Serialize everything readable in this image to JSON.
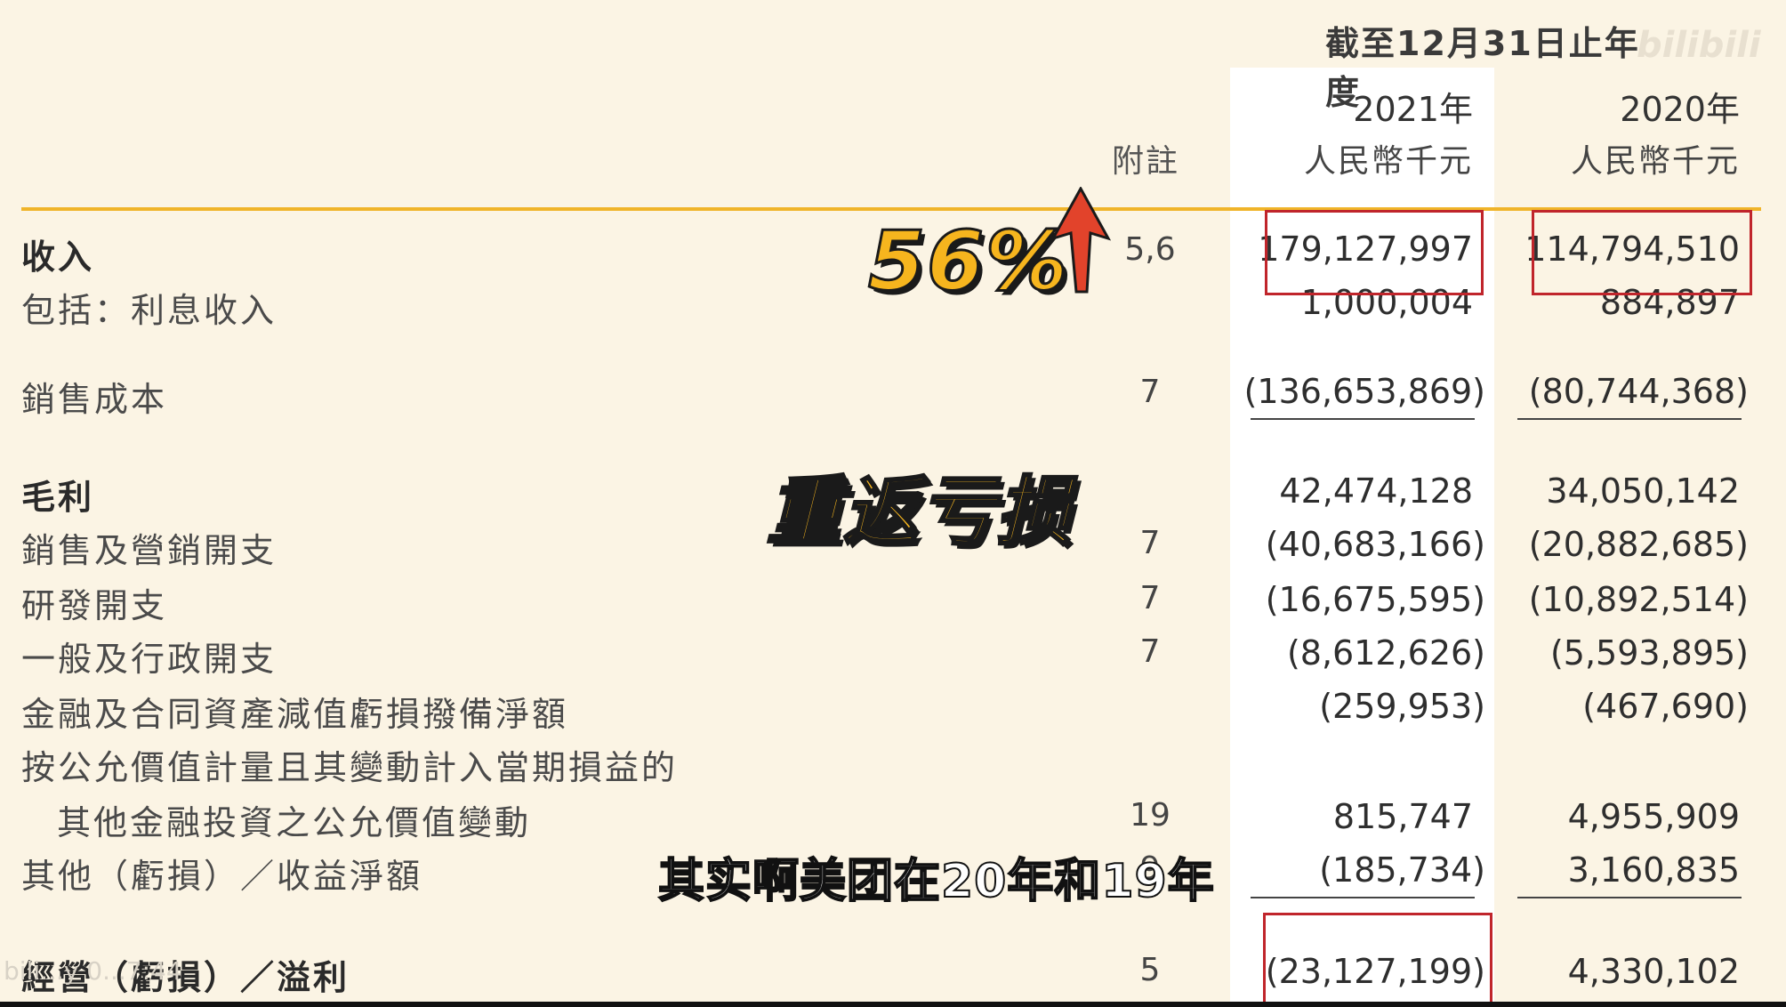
{
  "header": {
    "period": "截至12月31日止年度",
    "watermark": "bilibili",
    "note_label": "附註",
    "year_2021": "2021年",
    "year_2020": "2020年",
    "unit_2021": "人民幣千元",
    "unit_2020": "人民幣千元"
  },
  "rows": [
    {
      "label": "收入",
      "note": "5,6",
      "y2021": "179,127,997",
      "y2020": "114,794,510"
    },
    {
      "label": "包括：利息收入",
      "note": "",
      "y2021": "1,000,004",
      "y2020": "884,897"
    },
    {
      "label": "銷售成本",
      "note": "7",
      "y2021": "(136,653,869)",
      "y2020": "(80,744,368)"
    },
    {
      "label": "毛利",
      "note": "",
      "y2021": "42,474,128",
      "y2020": "34,050,142"
    },
    {
      "label": "銷售及營銷開支",
      "note": "7",
      "y2021": "(40,683,166)",
      "y2020": "(20,882,685)"
    },
    {
      "label": "研發開支",
      "note": "7",
      "y2021": "(16,675,595)",
      "y2020": "(10,892,514)"
    },
    {
      "label": "一般及行政開支",
      "note": "7",
      "y2021": "(8,612,626)",
      "y2020": "(5,593,895)"
    },
    {
      "label": "金融及合同資產減值虧損撥備淨額",
      "note": "",
      "y2021": "(259,953)",
      "y2020": "(467,690)"
    },
    {
      "label": "按公允價值計量且其變動計入當期損益的",
      "note": "",
      "y2021": "",
      "y2020": ""
    },
    {
      "label": "其他金融投資之公允價值變動",
      "note": "19",
      "y2021": "815,747",
      "y2020": "4,955,909"
    },
    {
      "label": "其他（虧損）／收益淨額",
      "note": "9",
      "y2021": "(185,734)",
      "y2020": "3,160,835"
    },
    {
      "label": "經營（虧損）／溢利",
      "note": "5",
      "y2021": "(23,127,199)",
      "y2020": "4,330,102"
    }
  ],
  "overlays": {
    "growth_sticker": "56%",
    "loss_sticker": "重返亏损",
    "subtitle": "其实啊美团在20年和19年",
    "timestamp": "bili...y  0...7:44"
  },
  "colors": {
    "background": "#fbf4e4",
    "highlight_column": "#ffffff",
    "rule": "#f0b429",
    "box": "#c0252b",
    "sticker": "#f6b51e"
  }
}
